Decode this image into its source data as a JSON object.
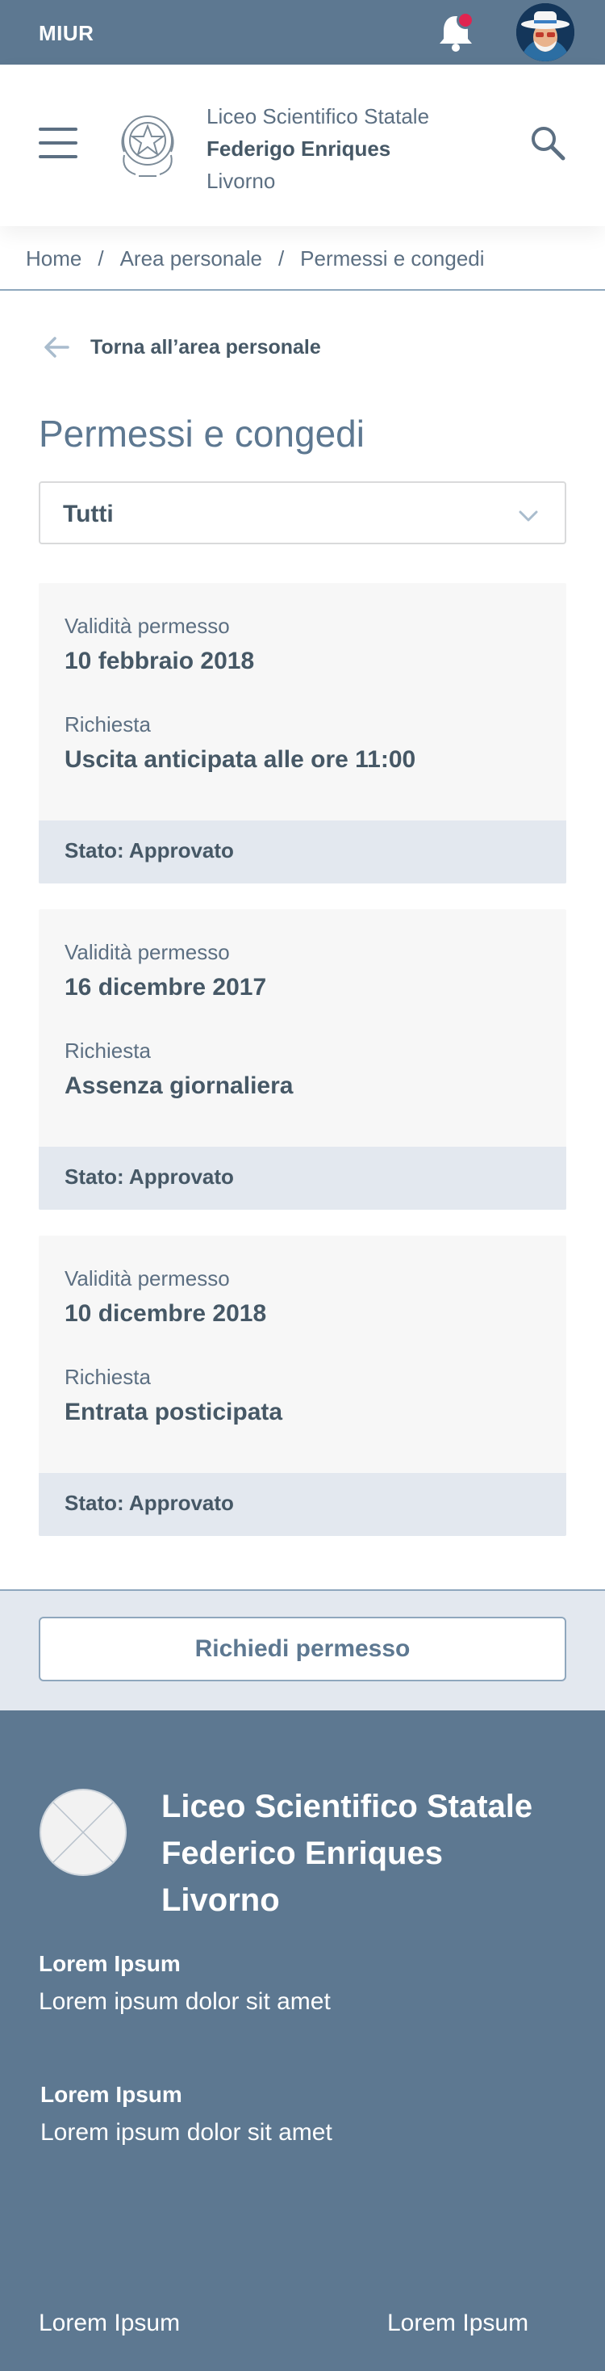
{
  "topbar": {
    "brand": "MIUR",
    "colors": {
      "background": "#5d7891",
      "notification": "#e02450"
    }
  },
  "header": {
    "school_line1": "Liceo Scientifico Statale",
    "school_line2": "Federigo Enriques",
    "school_line3": "Livorno"
  },
  "breadcrumb": {
    "items": [
      "Home",
      "Area personale",
      "Permessi e congedi"
    ],
    "separator": "/"
  },
  "back_link": {
    "label": "Torna all’area personale"
  },
  "page_title": "Permessi e congedi",
  "filter": {
    "selected": "Tutti"
  },
  "cards": [
    {
      "validity_label": "Validità permesso",
      "validity_value": "10 febbraio 2018",
      "request_label": "Richiesta",
      "request_value": "Uscita anticipata alle ore 11:00",
      "status": "Stato: Approvato"
    },
    {
      "validity_label": "Validità permesso",
      "validity_value": "16 dicembre 2017",
      "request_label": "Richiesta",
      "request_value": "Assenza giornaliera",
      "status": "Stato: Approvato"
    },
    {
      "validity_label": "Validità permesso",
      "validity_value": "10 dicembre 2018",
      "request_label": "Richiesta",
      "request_value": "Entrata posticipata",
      "status": "Stato: Approvato"
    }
  ],
  "request_button": {
    "label": "Richiedi permesso"
  },
  "footer": {
    "title_line1": "Liceo Scientifico Statale",
    "title_line2": "Federico Enriques",
    "title_line3": "Livorno",
    "blocks": [
      {
        "heading": "Lorem Ipsum",
        "text": "Lorem ipsum dolor sit amet"
      },
      {
        "heading": "Lorem Ipsum",
        "text": "Lorem ipsum dolor sit amet"
      }
    ],
    "links": [
      "Lorem Ipsum",
      "Lorem Ipsum"
    ]
  }
}
